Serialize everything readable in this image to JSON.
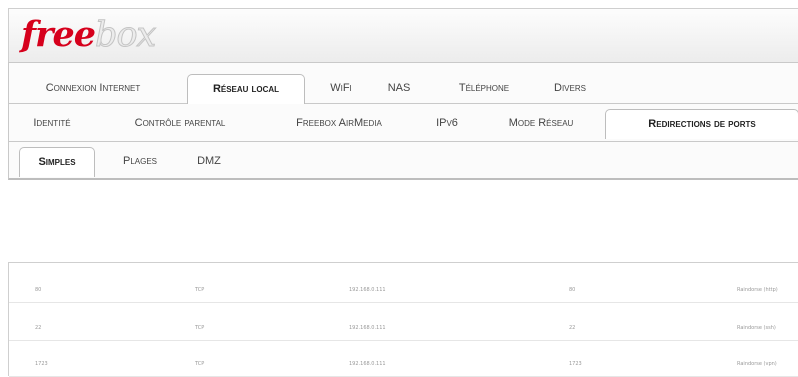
{
  "logo": {
    "part1": "free",
    "part2": "box"
  },
  "tabs_row1": {
    "items": [
      "Connexion Internet",
      "Réseau local",
      "WiFi",
      "NAS",
      "Téléphone",
      "Divers"
    ],
    "active_index": 1
  },
  "tabs_row2": {
    "items": [
      "Identité",
      "Contrôle parental",
      "Freebox AirMedia",
      "IPv6",
      "Mode Réseau",
      "Redirections de ports"
    ],
    "active_index": 5
  },
  "tabs_row3": {
    "items": [
      "Simples",
      "Plages",
      "DMZ"
    ],
    "active_index": 0
  },
  "port_rules": [
    {
      "port": "80",
      "protocol": "TCP",
      "ip": "192.168.0.111",
      "dest_port": "80",
      "comment": "Raindorse (http)"
    },
    {
      "port": "22",
      "protocol": "TCP",
      "ip": "192.168.0.111",
      "dest_port": "22",
      "comment": "Raindorse (ssh)"
    },
    {
      "port": "1723",
      "protocol": "TCP",
      "ip": "192.168.0.111",
      "dest_port": "1723",
      "comment": "Raindorse (vpn)"
    }
  ]
}
